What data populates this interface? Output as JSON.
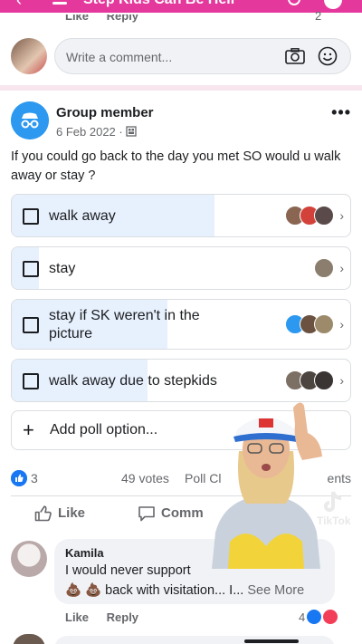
{
  "header": {
    "title": "Step Kids Can Be Hell"
  },
  "prev_comment": {
    "like": "Like",
    "reply": "Reply",
    "count": "2"
  },
  "composer": {
    "placeholder": "Write a comment..."
  },
  "post": {
    "author": "Group member",
    "date": "6 Feb 2022 · ",
    "text": "If you could go back to the day you met SO would u walk away or stay ?"
  },
  "poll": {
    "options": [
      {
        "label": "walk away",
        "fill": 0.6
      },
      {
        "label": "stay",
        "fill": 0.08
      },
      {
        "label": "stay if SK weren't in the picture",
        "fill": 0.46
      },
      {
        "label": "walk away due to stepkids",
        "fill": 0.4
      }
    ],
    "add_option": "Add poll option..."
  },
  "stats": {
    "likes": "3",
    "votes": "49 votes",
    "poll_closed": "Poll Cl",
    "comments": "ents"
  },
  "actions": {
    "like": "Like",
    "comment": "Comm"
  },
  "comment": {
    "author": "Kamila",
    "text": "I would never support",
    "text2": "back with visitation... I...",
    "see_more": "See More",
    "like": "Like",
    "reply": "Reply",
    "reactions": "4"
  },
  "watermark": {
    "text": "TikTok"
  },
  "colors": {
    "brand": "#e5389c",
    "fb_blue": "#1877f2",
    "poll_fill": "#e7f0fd"
  }
}
